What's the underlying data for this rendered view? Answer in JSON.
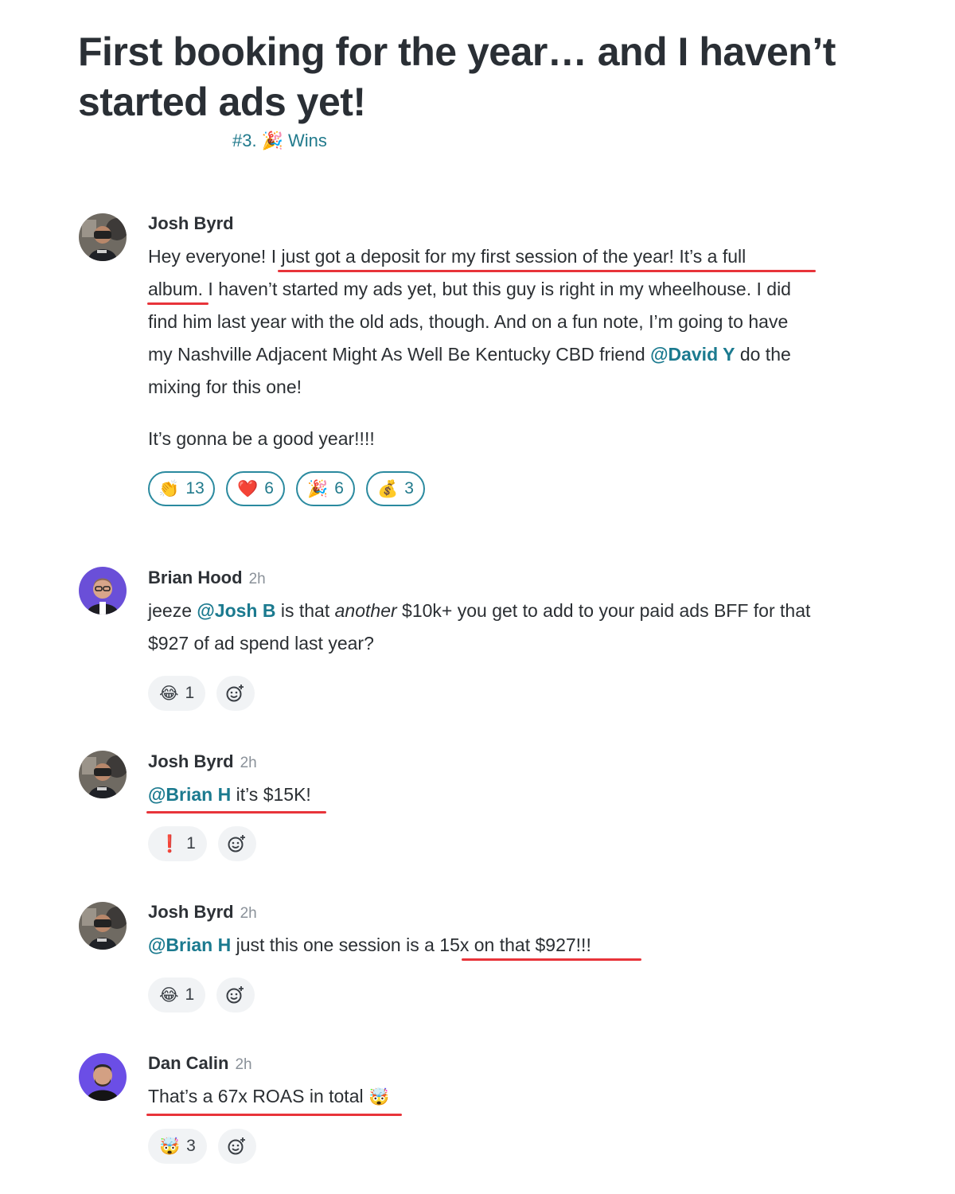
{
  "post": {
    "title": "First booking for the year… and I haven’t started ads yet!",
    "channel": "#3.",
    "channel_name": "Wins"
  },
  "comments": [
    {
      "author": "Josh Byrd",
      "time": "",
      "p1_a": "Hey everyone! ",
      "p1_b": "I just got a deposit for my first session of the year! It’s a full",
      "p2_a": "album.",
      "p2_b": " I haven’t started my ads yet, but this guy is right in my wheelhouse. I did",
      "p3": "find him last year with the old ads, though. And on a fun note, I’m going to have",
      "p4_a": "my Nashville Adjacent Might As Well Be Kentucky CBD friend ",
      "p4_mention": "@David Y",
      "p4_b": " do the",
      "p5": "mixing for this one!",
      "p6": "It’s gonna be a good year!!!!",
      "reactions": [
        {
          "emoji": "clap",
          "glyph": "👏",
          "count": "13"
        },
        {
          "emoji": "heart",
          "glyph": "❤️",
          "count": "6"
        },
        {
          "emoji": "party",
          "glyph": "🎉",
          "count": "6"
        },
        {
          "emoji": "money-bag",
          "glyph": "💰",
          "count": "3"
        }
      ]
    },
    {
      "author": "Brian Hood",
      "time": "2h",
      "l1_a": "jeeze ",
      "l1_mention": "@Josh B",
      "l1_b": " is that ",
      "l1_em": "another",
      "l1_c": " $10k+ you get to add to your paid ads BFF for that",
      "l2": "$927 of ad spend last year?",
      "reactions": [
        {
          "emoji": "joy",
          "glyph": "😂",
          "count": "1"
        }
      ]
    },
    {
      "author": "Josh Byrd",
      "time": "2h",
      "mention": "@Brian H",
      "text": " it’s $15K!",
      "reactions": [
        {
          "emoji": "exclamation",
          "glyph": "❗",
          "count": "1"
        }
      ]
    },
    {
      "author": "Josh Byrd",
      "time": "2h",
      "mention": "@Brian H",
      "text_a": " just this one session is a ",
      "text_b": "15x on that $927!!!",
      "reactions": [
        {
          "emoji": "joy",
          "glyph": "😂",
          "count": "1"
        }
      ]
    },
    {
      "author": "Dan Calin",
      "time": "2h",
      "text": "That’s a 67x ROAS in total",
      "glyph": "🤯",
      "reactions": [
        {
          "emoji": "exploding-head",
          "glyph": "🤯",
          "count": "3"
        }
      ]
    }
  ],
  "colors": {
    "accent": "#217a8c",
    "underline": "#e8343a",
    "pill_bg": "#f1f3f5",
    "title": "#2a2f35",
    "brian_avatar_bg": "#6a4fd8",
    "dan_avatar_bg": "#6b4ee6"
  }
}
